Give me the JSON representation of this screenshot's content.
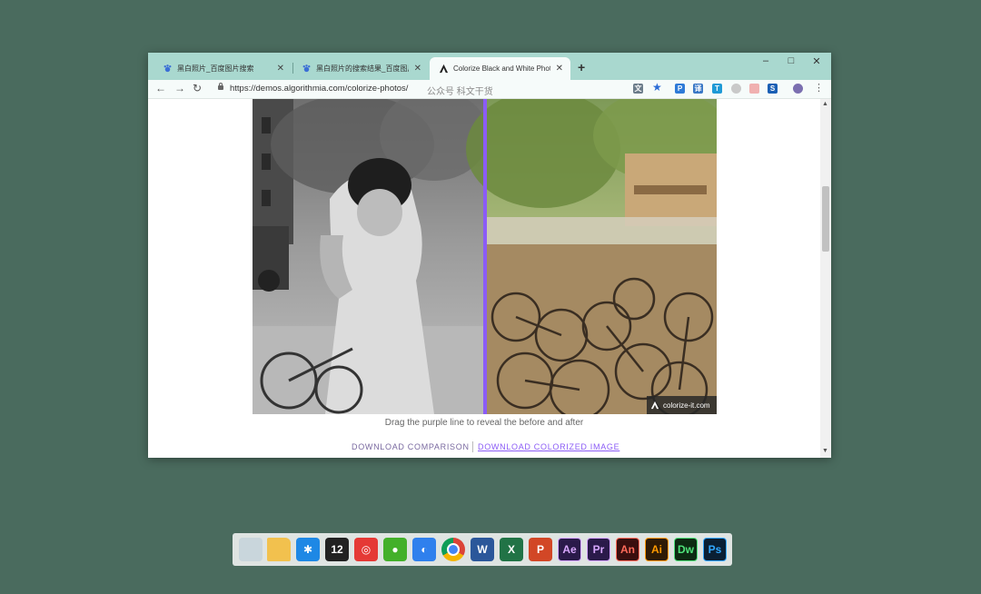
{
  "browser": {
    "tabs": [
      {
        "title": "黑白照片_百度图片搜索",
        "active": false
      },
      {
        "title": "黑白照片的搜索结果_百度图片搜",
        "active": false
      },
      {
        "title": "Colorize Black and White Phot",
        "active": true
      }
    ],
    "window_controls": {
      "minimize": "–",
      "maximize": "□",
      "close": "✕"
    },
    "url": "https://demos.algorithmia.com/colorize-photos/",
    "watermark": "公众号  科文干货"
  },
  "page": {
    "badge_text": "colorize-it.com",
    "caption": "Drag the purple line to reveal the before and after",
    "download_comparison": "DOWNLOAD COMPARISON",
    "download_colorized": "DOWNLOAD COLORIZED IMAGE"
  },
  "taskbar": {
    "apps": [
      {
        "name": "recycle-bin",
        "label": "",
        "color": "#c9d6dc"
      },
      {
        "name": "folder",
        "label": "",
        "color": "#f2c14e"
      },
      {
        "name": "app-star",
        "label": "✱",
        "color": "#1e88e5"
      },
      {
        "name": "app-12",
        "label": "12",
        "color": "#222222"
      },
      {
        "name": "netease-music",
        "label": "◎",
        "color": "#e53935"
      },
      {
        "name": "wechat",
        "label": "●",
        "color": "#43b02a"
      },
      {
        "name": "app-blue-circle",
        "label": "◐",
        "color": "#2f80ed"
      },
      {
        "name": "chrome",
        "label": "",
        "color": "#ffffff"
      },
      {
        "name": "word",
        "label": "W",
        "color": "#2b579a"
      },
      {
        "name": "excel",
        "label": "X",
        "color": "#217346"
      },
      {
        "name": "powerpoint",
        "label": "P",
        "color": "#d24726"
      },
      {
        "name": "after-effects",
        "label": "Ae",
        "color": "#2a1a4a"
      },
      {
        "name": "premiere",
        "label": "Pr",
        "color": "#2a1a4a"
      },
      {
        "name": "animate",
        "label": "An",
        "color": "#3a0e0e"
      },
      {
        "name": "illustrator",
        "label": "Ai",
        "color": "#2e1a05"
      },
      {
        "name": "dreamweaver",
        "label": "Dw",
        "color": "#0d2a12"
      },
      {
        "name": "photoshop",
        "label": "Ps",
        "color": "#0a1f33"
      }
    ]
  }
}
